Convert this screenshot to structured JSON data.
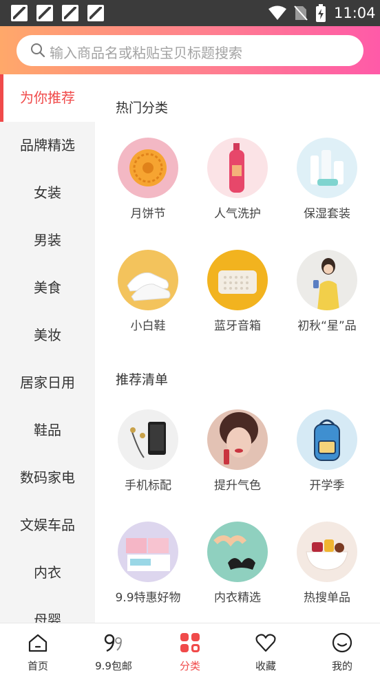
{
  "status_bar": {
    "time": "11:04",
    "notification_icons": [
      "app-notification-icon",
      "app-notification-icon",
      "app-notification-icon",
      "app-notification-icon"
    ],
    "icons": [
      "wifi-icon",
      "no-sim-icon",
      "battery-charging-icon"
    ]
  },
  "search": {
    "placeholder": "输入商品名或粘贴宝贝标题搜索",
    "icon": "search-icon"
  },
  "sidebar": {
    "active_index": 0,
    "items": [
      {
        "label": "为你推荐"
      },
      {
        "label": "品牌精选"
      },
      {
        "label": "女装"
      },
      {
        "label": "男装"
      },
      {
        "label": "美食"
      },
      {
        "label": "美妆"
      },
      {
        "label": "居家日用"
      },
      {
        "label": "鞋品"
      },
      {
        "label": "数码家电"
      },
      {
        "label": "文娱车品"
      },
      {
        "label": "内衣"
      },
      {
        "label": "母婴"
      }
    ]
  },
  "sections": [
    {
      "title": "热门分类",
      "items": [
        {
          "label": "月饼节",
          "image": "mooncake-image"
        },
        {
          "label": "人气洗护",
          "image": "shampoo-image"
        },
        {
          "label": "保湿套装",
          "image": "skincare-set-image"
        },
        {
          "label": "小白鞋",
          "image": "white-sneaker-image"
        },
        {
          "label": "蓝牙音箱",
          "image": "bluetooth-speaker-image"
        },
        {
          "label": "初秋“星”品",
          "image": "autumn-fashion-image"
        }
      ]
    },
    {
      "title": "推荐清单",
      "items": [
        {
          "label": "手机标配",
          "image": "earphones-image"
        },
        {
          "label": "提升气色",
          "image": "lipstick-model-image"
        },
        {
          "label": "开学季",
          "image": "backpack-image"
        },
        {
          "label": "9.9特惠好物",
          "image": "tissue-pack-image"
        },
        {
          "label": "内衣精选",
          "image": "bra-image"
        },
        {
          "label": "热搜单品",
          "image": "snack-bowl-image"
        }
      ]
    }
  ],
  "bottom_nav": {
    "active_index": 2,
    "items": [
      {
        "label": "首页",
        "icon": "home-icon"
      },
      {
        "label": "9.9包邮",
        "icon": "nine-nine-icon"
      },
      {
        "label": "分类",
        "icon": "category-grid-icon"
      },
      {
        "label": "收藏",
        "icon": "heart-icon"
      },
      {
        "label": "我的",
        "icon": "smile-profile-icon"
      }
    ]
  },
  "colors": {
    "accent": "#f04a4a",
    "header_gradient_start": "#ffa86a",
    "header_gradient_end": "#ff5aa8",
    "sidebar_bg": "#f4f4f4",
    "status_bar_bg": "#3b3b3b"
  }
}
